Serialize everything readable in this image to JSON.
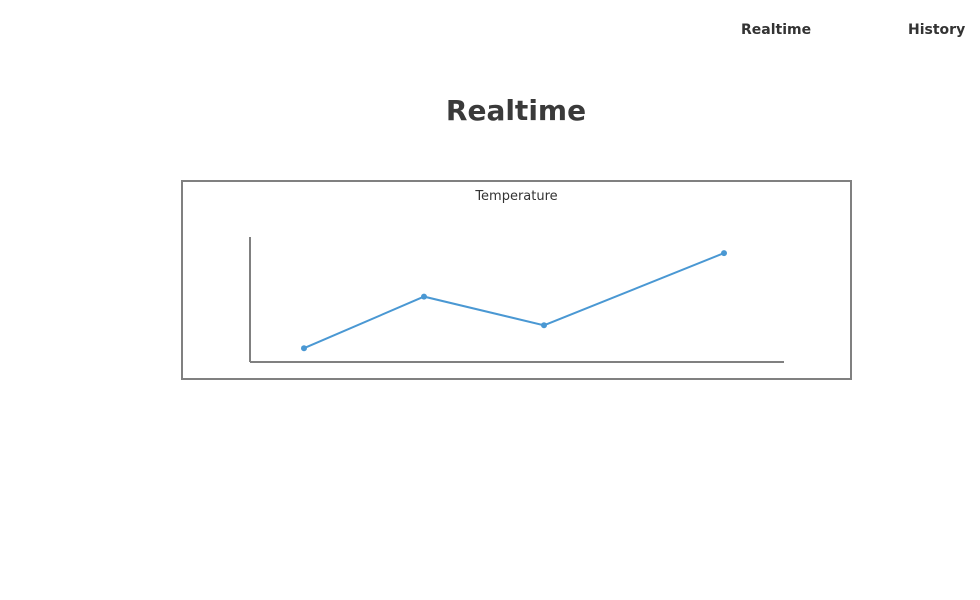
{
  "nav": {
    "realtime_label": "Realtime",
    "history_label": "History"
  },
  "page": {
    "title": "Realtime"
  },
  "chart_data": {
    "type": "line",
    "title": "Temperature",
    "xlabel": "",
    "ylabel": "",
    "x": [
      1,
      2,
      3,
      4.5
    ],
    "series": [
      {
        "values": [
          10,
          55,
          30,
          93
        ],
        "color": "#4a98d3"
      }
    ],
    "xlim": [
      0.55,
      5
    ],
    "ylim": [
      -2,
      107
    ],
    "grid": false,
    "show_ticks": false,
    "axis_color": "#808080"
  }
}
